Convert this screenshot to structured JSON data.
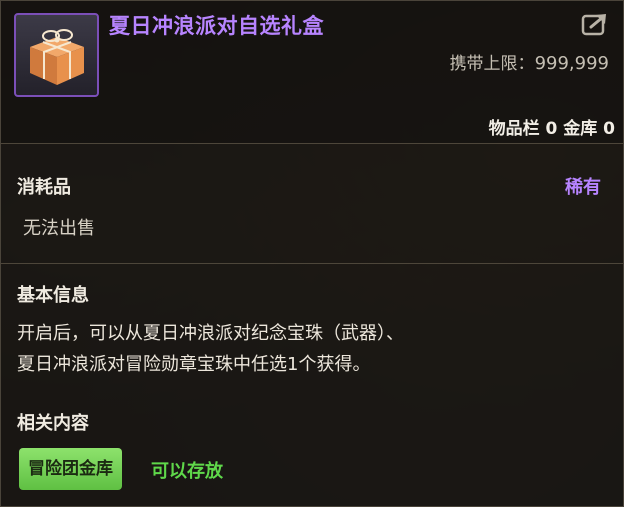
{
  "item": {
    "name": "夏日冲浪派对自选礼盒",
    "carry_limit_label": "携带上限：",
    "carry_limit_value": "999,999",
    "storage": "物品栏 0 金库 0",
    "rarity_color": "#b784ff",
    "icon": "gift-box-icon"
  },
  "type_section": {
    "category": "消耗品",
    "rarity": "稀有",
    "sell_status": "无法出售"
  },
  "info_section": {
    "label": "基本信息",
    "description_line1": "开启后，可以从夏日冲浪派对纪念宝珠（武器）、",
    "description_line2": "夏日冲浪派对冒险勋章宝珠中任选1个获得。"
  },
  "related_section": {
    "label": "相关内容",
    "tag": "冒险团金库",
    "tag_color": "#6fd04f",
    "note": "可以存放"
  },
  "share": {
    "icon": "share-icon"
  }
}
